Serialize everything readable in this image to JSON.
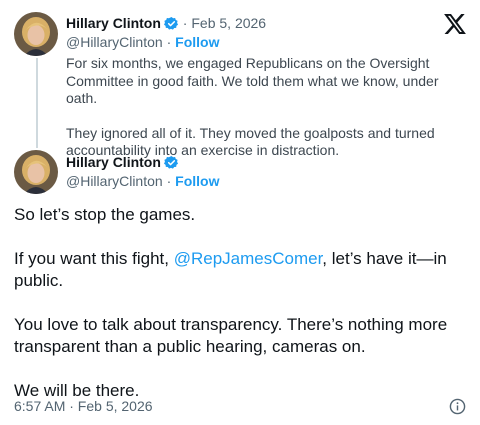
{
  "parent_tweet": {
    "author_name": "Hillary Clinton",
    "separator": "·",
    "date": "Feb 5, 2026",
    "handle": "@HillaryClinton",
    "follow_label": "Follow",
    "paragraphs": [
      "For six months, we engaged Republicans on the Oversight Committee in good faith. We told them what we know, under oath.",
      "They ignored all of it. They moved the goalposts and turned accountability into an exercise in distraction."
    ]
  },
  "main_tweet": {
    "author_name": "Hillary Clinton",
    "handle": "@HillaryClinton",
    "separator": "·",
    "follow_label": "Follow",
    "p1": "So let’s stop the games.",
    "p2_before": "If you want this fight, ",
    "p2_mention": "@RepJamesComer",
    "p2_after": ", let’s have it—in public.",
    "p3": "You love to talk about transparency. There’s nothing more transparent than a public hearing, cameras on.",
    "p4": "We will be there.",
    "timestamp": "6:57 AM · Feb 5, 2026"
  },
  "icons": {
    "verified": "verified-badge-icon",
    "platform": "x-logo-icon",
    "info": "info-icon"
  },
  "colors": {
    "accent": "#1d9bf0",
    "text": "#0f1419",
    "muted": "#536471"
  }
}
